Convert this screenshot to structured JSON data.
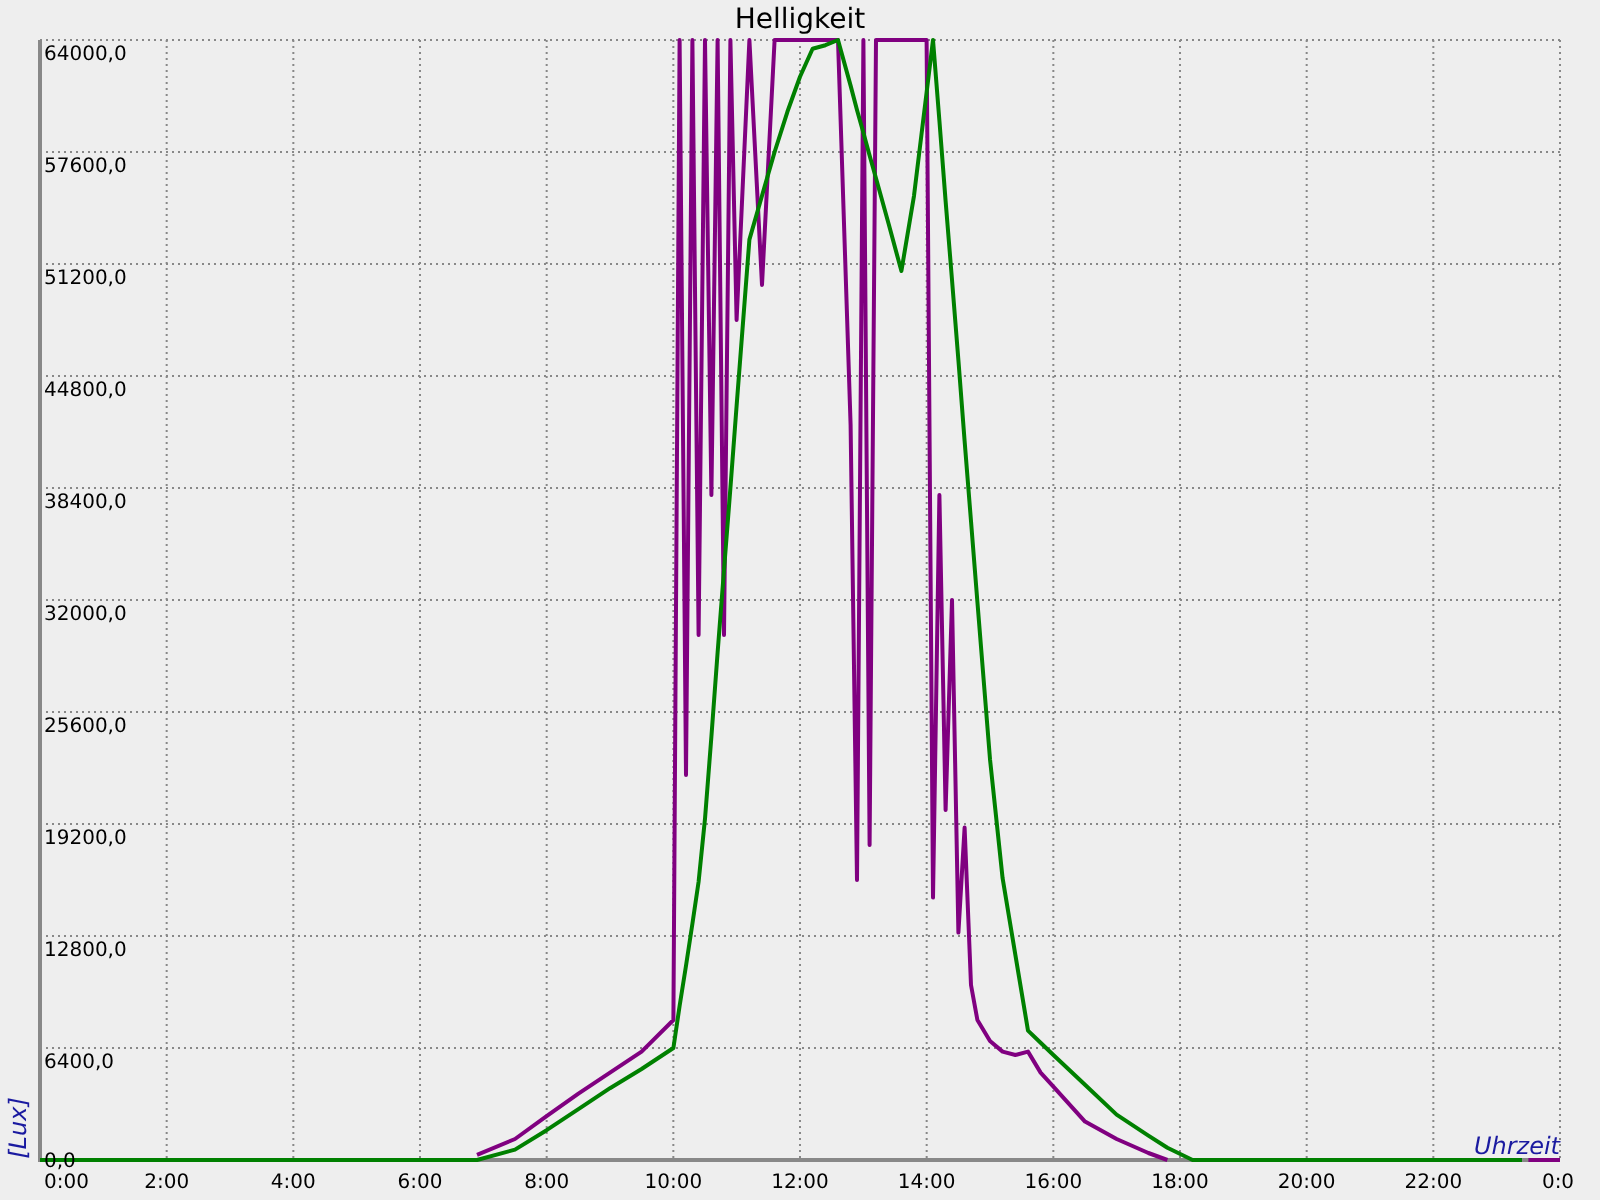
{
  "chart": {
    "chart_data": {
      "type": "line",
      "title": "Helligkeit",
      "xlabel": "Uhrzeit",
      "ylabel": "[Lux]",
      "grid": true,
      "x": [
        0,
        0.3,
        6,
        6.9,
        7.5,
        8,
        8.5,
        9,
        9.5,
        10,
        10.1,
        10.2,
        10.3,
        10.4,
        10.5,
        10.6,
        10.7,
        10.8,
        10.9,
        11.0,
        11.2,
        11.4,
        11.6,
        11.8,
        12.0,
        12.2,
        12.4,
        12.6,
        12.8,
        12.9,
        13.0,
        13.1,
        13.2,
        13.4,
        13.6,
        13.8,
        14.0,
        14.1,
        14.2,
        14.3,
        14.4,
        14.5,
        14.6,
        14.7,
        14.8,
        15.0,
        15.2,
        15.4,
        15.6,
        15.8,
        16.0,
        16.5,
        17.0,
        17.5,
        17.8,
        18.2,
        20,
        22,
        23.4,
        23.5,
        24
      ],
      "series": [
        {
          "color": "#800080",
          "values": [
            null,
            null,
            null,
            300,
            1200,
            2500,
            3800,
            5000,
            6200,
            8000,
            64000,
            22000,
            64000,
            30000,
            64000,
            38000,
            64000,
            30000,
            64000,
            48000,
            64000,
            50000,
            64000,
            64000,
            64000,
            64000,
            64000,
            64000,
            42000,
            16000,
            64000,
            18000,
            64000,
            64000,
            64000,
            64000,
            64000,
            15000,
            38000,
            20000,
            32000,
            13000,
            19000,
            10000,
            8000,
            6800,
            6200,
            6000,
            6200,
            5000,
            4200,
            2200,
            1200,
            400,
            0,
            null,
            null,
            null,
            null,
            0,
            0
          ]
        },
        {
          "color": "#008000",
          "values": [
            0,
            0,
            0,
            0,
            600,
            1700,
            2900,
            4100,
            5200,
            6400,
            8800,
            11100,
            13500,
            15900,
            19500,
            24200,
            29000,
            33700,
            38400,
            43100,
            52600,
            55100,
            57600,
            59900,
            61900,
            63500,
            63700,
            64000,
            61400,
            60000,
            58700,
            57400,
            56100,
            53500,
            50800,
            55100,
            61000,
            64000,
            59400,
            54800,
            50300,
            45700,
            41100,
            36500,
            31900,
            22900,
            16100,
            11700,
            7400,
            6700,
            6000,
            4300,
            2600,
            1400,
            700,
            0,
            0,
            0,
            0,
            null,
            null
          ]
        }
      ],
      "xlim": [
        0,
        24
      ],
      "ylim": [
        0,
        64000
      ],
      "xticks": [
        {
          "value": 0,
          "label": "0:00"
        },
        {
          "value": 2,
          "label": "2:00"
        },
        {
          "value": 4,
          "label": "4:00"
        },
        {
          "value": 6,
          "label": "6:00"
        },
        {
          "value": 8,
          "label": "8:00"
        },
        {
          "value": 10,
          "label": "10:00"
        },
        {
          "value": 12,
          "label": "12:00"
        },
        {
          "value": 14,
          "label": "14:00"
        },
        {
          "value": 16,
          "label": "16:00"
        },
        {
          "value": 18,
          "label": "18:00"
        },
        {
          "value": 20,
          "label": "20:00"
        },
        {
          "value": 22,
          "label": "22:00"
        },
        {
          "value": 24,
          "label": "0:0"
        }
      ],
      "yticks": [
        {
          "value": 0,
          "label": "0,0"
        },
        {
          "value": 6400,
          "label": "6400,0"
        },
        {
          "value": 12800,
          "label": "12800,0"
        },
        {
          "value": 19200,
          "label": "19200,0"
        },
        {
          "value": 25600,
          "label": "25600,0"
        },
        {
          "value": 32000,
          "label": "32000,0"
        },
        {
          "value": 38400,
          "label": "38400,0"
        },
        {
          "value": 44800,
          "label": "44800,0"
        },
        {
          "value": 51200,
          "label": "51200,0"
        },
        {
          "value": 57600,
          "label": "57600,0"
        },
        {
          "value": 64000,
          "label": "64000,0"
        }
      ]
    }
  }
}
